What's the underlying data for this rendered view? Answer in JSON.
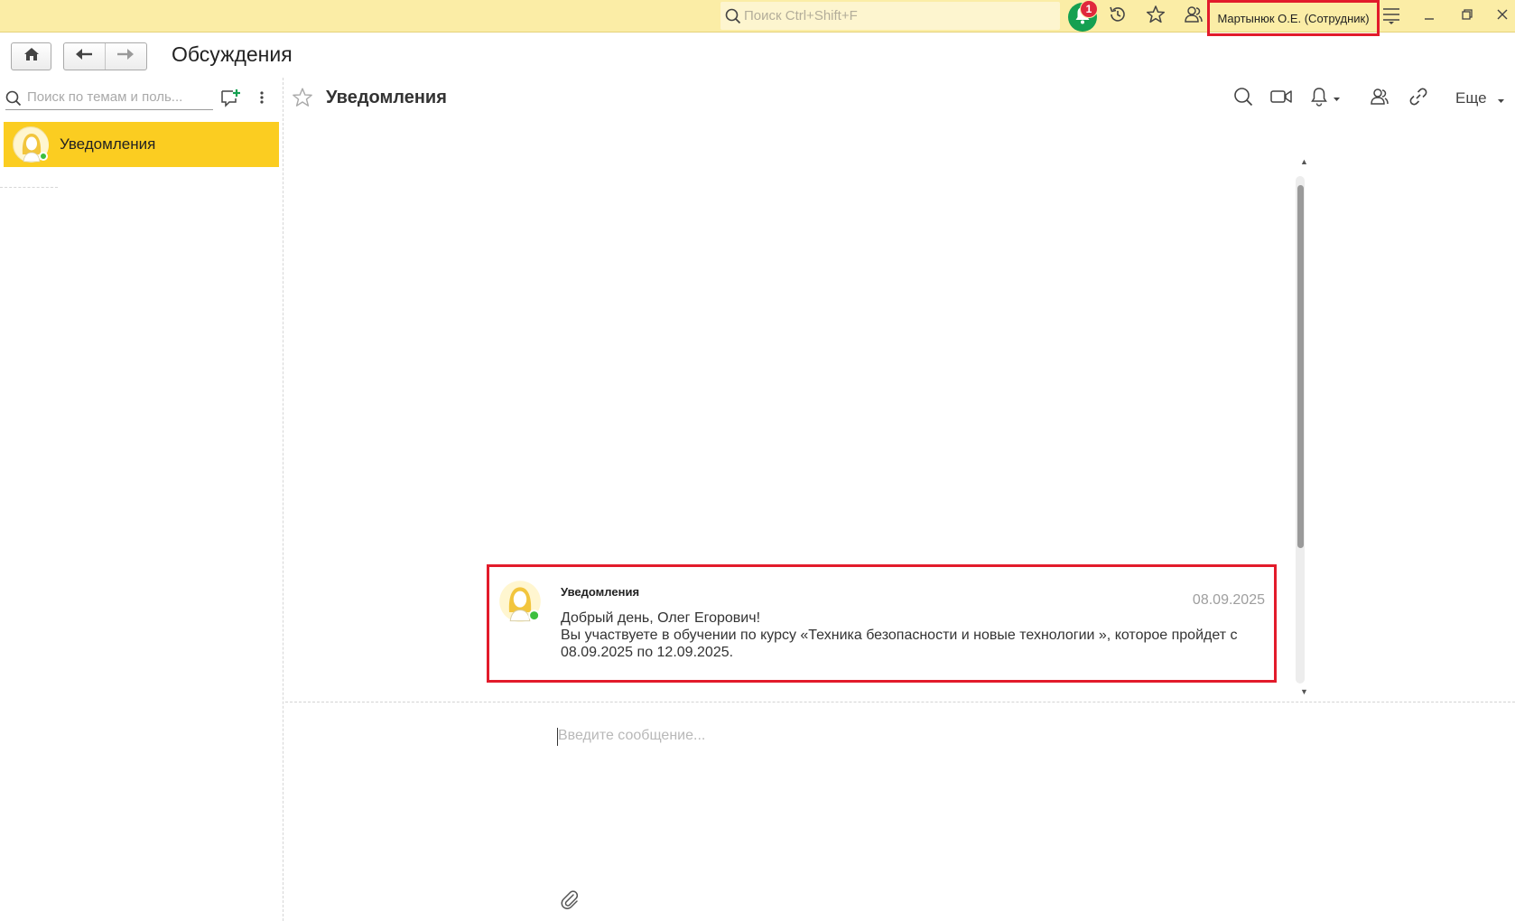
{
  "topbar": {
    "search_placeholder": "Поиск Ctrl+Shift+F",
    "notifications_count": "1",
    "user": "Мартынюк О.Е. (Сотрудник)"
  },
  "nav": {
    "page_title": "Обсуждения"
  },
  "sidebar": {
    "search_placeholder": "Поиск по темам и поль...",
    "conversations": [
      {
        "label": "Уведомления",
        "selected": true,
        "online": true
      }
    ]
  },
  "chat": {
    "title": "Уведомления",
    "more_label": "Еще",
    "message": {
      "sender": "Уведомления",
      "date": "08.09.2025",
      "line1": "Добрый день, Олег Егорович!",
      "line2": "Вы участвуете в обучении по курсу «Техника безопасности и новые технологии », которое пройдет с 08.09.2025 по 12.09.2025."
    },
    "input_placeholder": "Введите сообщение..."
  },
  "colors": {
    "topbar_bg": "#fbeda6",
    "selected_item": "#fbcd21",
    "highlight_border": "#e21b2b",
    "bell_green": "#14a051",
    "badge_red": "#e0283c"
  }
}
